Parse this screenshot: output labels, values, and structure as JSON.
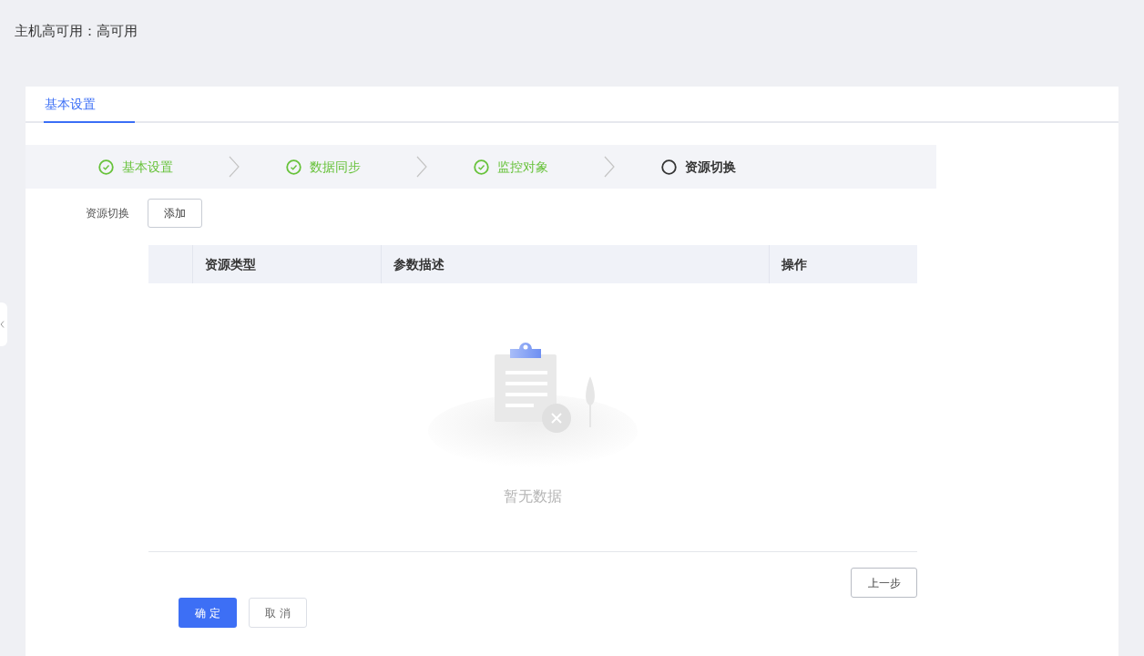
{
  "page_title": "主机高可用：高可用",
  "tabs": [
    {
      "label": "基本设置",
      "selected": true
    }
  ],
  "steps": [
    {
      "label": "基本设置",
      "completed": true
    },
    {
      "label": "数据同步",
      "completed": true
    },
    {
      "label": "监控对象",
      "completed": true
    },
    {
      "label": "资源切换",
      "completed": false
    }
  ],
  "form": {
    "label": "资源切换",
    "add_button": "添加"
  },
  "table": {
    "columns": [
      "",
      "资源类型",
      "参数描述",
      "操作"
    ],
    "empty_text": "暂无数据"
  },
  "prev_button": "上一步",
  "buttons": [
    {
      "label": "确 定",
      "kind": "primary"
    },
    {
      "label": "取 消",
      "kind": "default"
    }
  ]
}
